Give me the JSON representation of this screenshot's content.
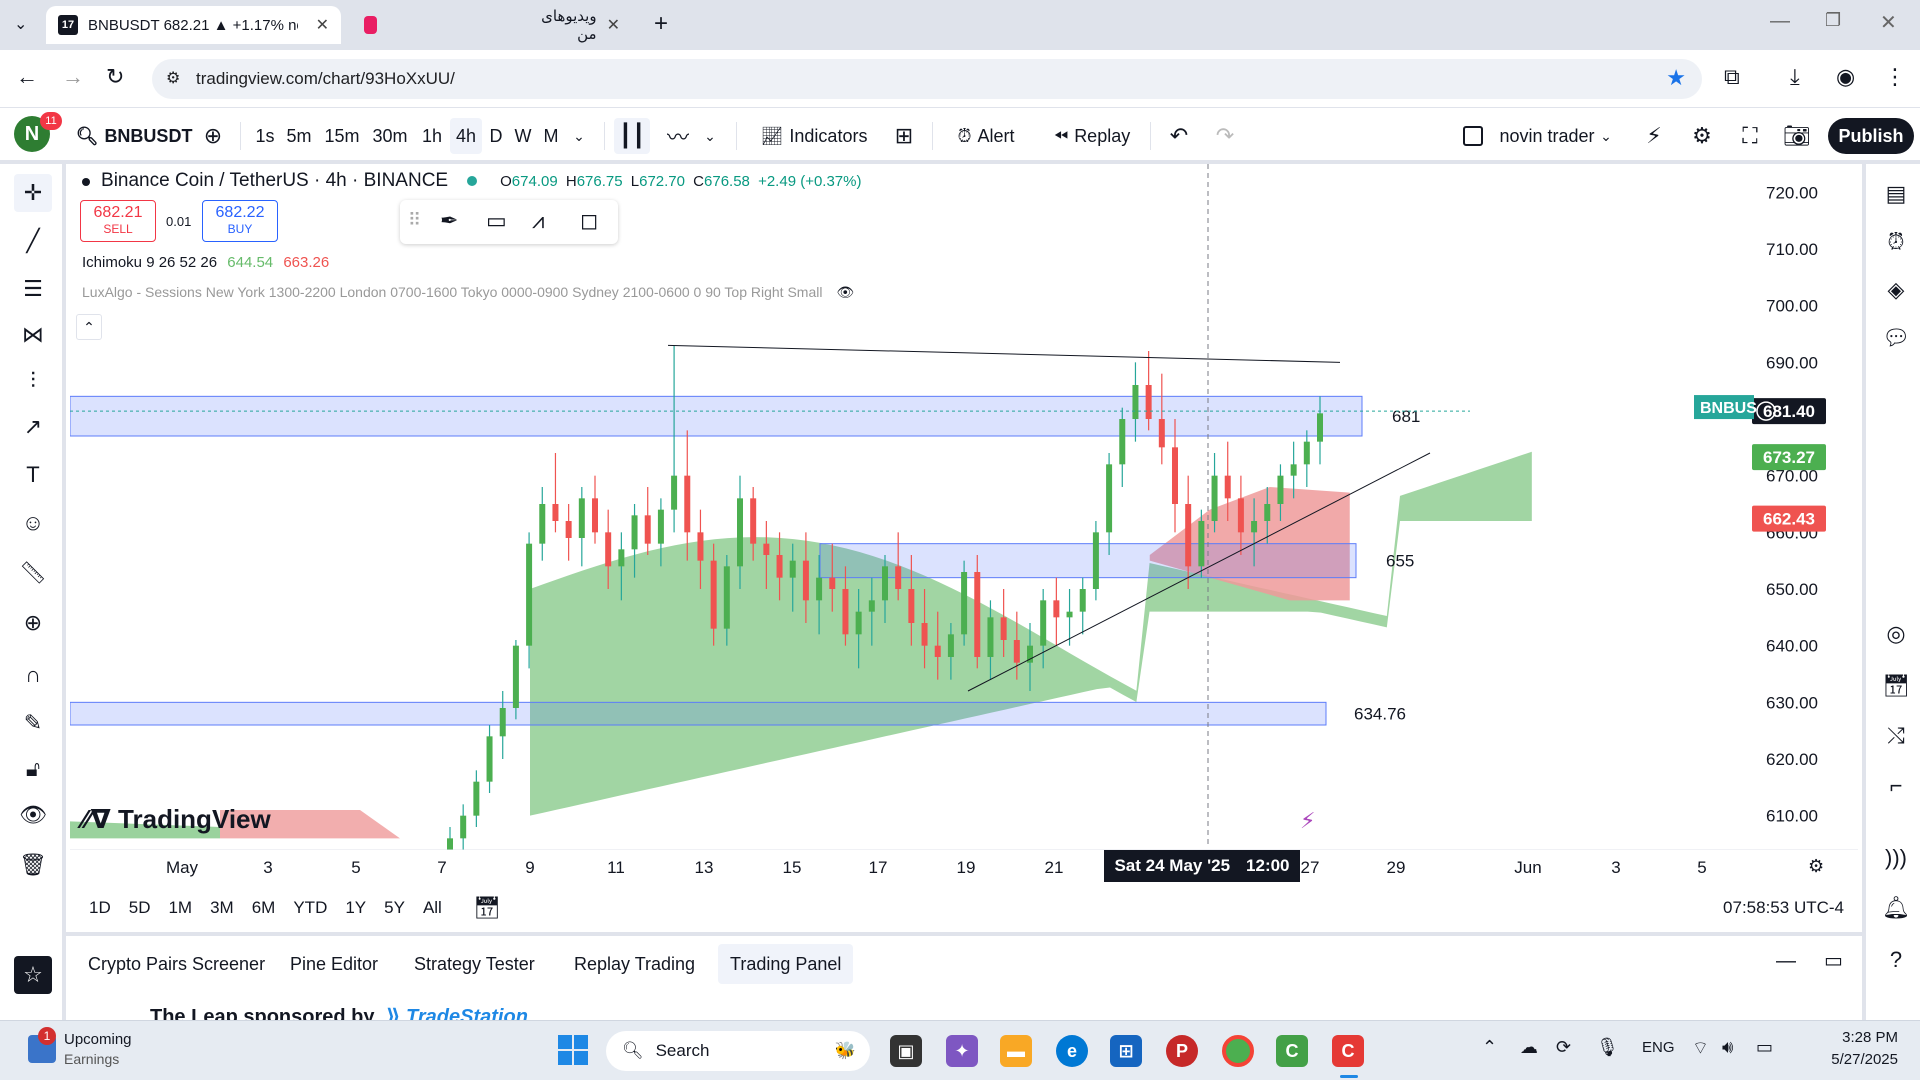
{
  "browser": {
    "tabs": [
      {
        "title": "BNBUSDT 682.21 ▲ +1.17% no",
        "active": true
      },
      {
        "title": "ویدیوهای من",
        "active": false
      }
    ],
    "url": "tradingview.com/chart/93HoXxUU/"
  },
  "header": {
    "notif_count": "11",
    "avatar_letter": "N",
    "symbol": "BNBUSDT",
    "intervals": [
      "1s",
      "5m",
      "15m",
      "30m",
      "1h",
      "4h",
      "D",
      "W",
      "M"
    ],
    "selected_interval": "4h",
    "indicators_label": "Indicators",
    "alert_label": "Alert",
    "replay_label": "Replay",
    "layout_name": "novin trader",
    "publish_label": "Publish"
  },
  "legend": {
    "title": "Binance Coin / TetherUS · 4h · BINANCE",
    "o_label": "O",
    "o": "674.09",
    "h_label": "H",
    "h": "676.75",
    "l_label": "L",
    "l": "672.70",
    "c_label": "C",
    "c": "676.58",
    "change": "+2.49 (+0.37%)",
    "sell_price": "682.21",
    "sell_label": "SELL",
    "spread": "0.01",
    "buy_price": "682.22",
    "buy_label": "BUY",
    "ichimoku_name": "Ichimoku 9 26 52 26",
    "ichimoku_v1": "644.54",
    "ichimoku_v2": "663.26",
    "luxalgo": "LuxAlgo - Sessions New York 1300-2200 London 0700-1600 Tokyo 0000-0900 Sydney 2100-0600 0 90 Top Right Small"
  },
  "chart_data": {
    "type": "candlestick",
    "symbol": "BNBUSDT",
    "yaxis_ticks": [
      "720.00",
      "710.00",
      "700.00",
      "690.00",
      "670.00",
      "660.00",
      "650.00",
      "640.00",
      "630.00",
      "620.00",
      "610.00"
    ],
    "ylim": [
      605,
      725
    ],
    "xaxis_ticks": [
      "May",
      "3",
      "5",
      "7",
      "9",
      "11",
      "13",
      "15",
      "17",
      "19",
      "21",
      "27",
      "29",
      "Jun",
      "3",
      "5"
    ],
    "crosshair_date": "Sat 24 May '25",
    "crosshair_time": "12:00",
    "price_labels": [
      {
        "label": "BNBUS",
        "value": "681.40",
        "color": "#26a69a"
      },
      {
        "value": "673.27",
        "color": "#4caf50"
      },
      {
        "value": "662.43",
        "color": "#ef5350"
      }
    ],
    "zones": [
      {
        "label": "681",
        "top": 684,
        "bottom": 677
      },
      {
        "label": "655",
        "top": 658,
        "bottom": 652
      },
      {
        "label": "634.76",
        "top": 630,
        "bottom": 626
      }
    ],
    "time_label": "07:58:53 UTC-4",
    "watermark": "TradingView",
    "candles": [
      [
        603,
        608,
        601,
        606
      ],
      [
        606,
        612,
        604,
        610
      ],
      [
        610,
        618,
        608,
        616
      ],
      [
        616,
        626,
        614,
        624
      ],
      [
        624,
        632,
        620,
        629
      ],
      [
        629,
        641,
        627,
        640
      ],
      [
        640,
        660,
        636,
        658
      ],
      [
        658,
        668,
        655,
        665
      ],
      [
        665,
        674,
        660,
        662
      ],
      [
        662,
        665,
        655,
        659
      ],
      [
        659,
        668,
        654,
        666
      ],
      [
        666,
        670,
        658,
        660
      ],
      [
        660,
        664,
        650,
        654
      ],
      [
        654,
        660,
        648,
        657
      ],
      [
        657,
        665,
        652,
        663
      ],
      [
        663,
        668,
        656,
        658
      ],
      [
        658,
        666,
        654,
        664
      ],
      [
        664,
        693,
        660,
        670
      ],
      [
        670,
        678,
        655,
        660
      ],
      [
        660,
        664,
        650,
        655
      ],
      [
        655,
        658,
        640,
        643
      ],
      [
        643,
        656,
        640,
        654
      ],
      [
        654,
        670,
        650,
        666
      ],
      [
        666,
        668,
        655,
        658
      ],
      [
        658,
        662,
        650,
        656
      ],
      [
        656,
        660,
        648,
        652
      ],
      [
        652,
        658,
        646,
        655
      ],
      [
        655,
        660,
        644,
        648
      ],
      [
        648,
        656,
        642,
        652
      ],
      [
        652,
        658,
        646,
        650
      ],
      [
        650,
        654,
        640,
        642
      ],
      [
        642,
        650,
        636,
        646
      ],
      [
        646,
        652,
        640,
        648
      ],
      [
        648,
        656,
        644,
        654
      ],
      [
        654,
        660,
        648,
        650
      ],
      [
        650,
        656,
        640,
        644
      ],
      [
        644,
        650,
        636,
        640
      ],
      [
        640,
        646,
        634,
        638
      ],
      [
        638,
        644,
        634,
        642
      ],
      [
        642,
        655,
        640,
        653
      ],
      [
        653,
        656,
        636,
        638
      ],
      [
        638,
        648,
        634,
        645
      ],
      [
        645,
        650,
        638,
        641
      ],
      [
        641,
        646,
        634,
        637
      ],
      [
        637,
        644,
        632,
        640
      ],
      [
        640,
        650,
        636,
        648
      ],
      [
        648,
        652,
        640,
        645
      ],
      [
        645,
        650,
        640,
        646
      ],
      [
        646,
        652,
        642,
        650
      ],
      [
        650,
        662,
        648,
        660
      ],
      [
        660,
        674,
        656,
        672
      ],
      [
        672,
        682,
        668,
        680
      ],
      [
        680,
        690,
        676,
        686
      ],
      [
        686,
        692,
        678,
        680
      ],
      [
        680,
        688,
        672,
        675
      ],
      [
        675,
        680,
        660,
        665
      ],
      [
        665,
        670,
        650,
        654
      ],
      [
        654,
        664,
        652,
        662
      ],
      [
        662,
        674,
        660,
        670
      ],
      [
        670,
        676,
        662,
        666
      ],
      [
        666,
        670,
        656,
        660
      ],
      [
        660,
        666,
        654,
        662
      ],
      [
        662,
        668,
        658,
        665
      ],
      [
        665,
        672,
        662,
        670
      ],
      [
        670,
        676,
        666,
        672
      ],
      [
        672,
        678,
        668,
        676
      ],
      [
        676,
        684,
        672,
        681
      ]
    ]
  },
  "timeframes": [
    "1D",
    "5D",
    "1M",
    "3M",
    "6M",
    "YTD",
    "1Y",
    "5Y",
    "All"
  ],
  "panel_tabs": [
    "Crypto Pairs Screener",
    "Pine Editor",
    "Strategy Tester",
    "Replay Trading",
    "Trading Panel"
  ],
  "selected_panel": "Trading Panel",
  "sponsor_text": "The Leap sponsored by",
  "sponsor_brand": "TradeStation",
  "taskbar": {
    "weather_title": "Upcoming",
    "weather_sub": "Earnings",
    "weather_badge": "1",
    "search_label": "Search",
    "lang": "ENG",
    "time": "3:28 PM",
    "date": "5/27/2025"
  }
}
